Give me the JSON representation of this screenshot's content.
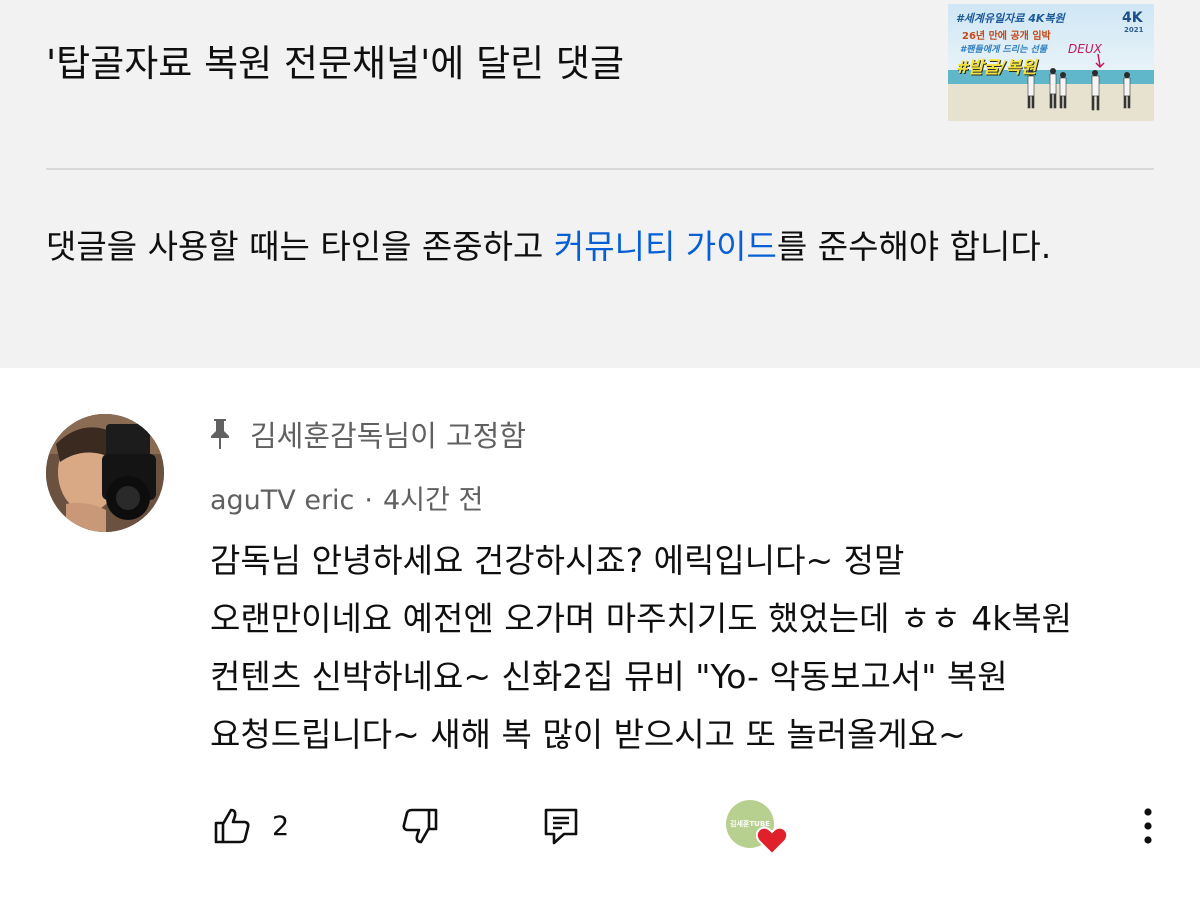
{
  "header": {
    "title": "'탑골자료 복원 전문채널'에 달린 댓글",
    "thumbnail": {
      "line1": "#세계유일자료 4K복원",
      "line2": "26년 만에 공개 임박",
      "line3": "#팬들에게 드리는 선물",
      "line4": "#발굴/복원",
      "badge": "4K",
      "year": "2021",
      "scribble": "DEUX"
    }
  },
  "notice": {
    "before": "댓글을 사용할 때는 타인을 존중하고 ",
    "link": "커뮤니티 가이드",
    "after": "를 준수해야 합니다."
  },
  "comment": {
    "pinned_by": "김세훈감독님이 고정함",
    "author": "aguTV eric",
    "separator": "·",
    "time": "4시간 전",
    "lines": [
      "감독님 안녕하세요 건강하시죠? 에릭입니다~ 정말",
      "오랜만이네요 예전엔 오가며 마주치기도 했었는데 ㅎㅎ 4k복원",
      "컨텐츠 신박하네요~ 신화2집 뮤비 \"Yo- 악동보고서\" 복원",
      "요청드립니다~ 새해 복 많이 받으시고 또 놀러올게요~"
    ],
    "likes": "2",
    "creator_badge_text": "김세훈TUBE"
  },
  "colors": {
    "link": "#065fd4",
    "secondary_text": "#606060",
    "panel_bg": "#f2f2f2",
    "heart": "#e0202a"
  },
  "icons": [
    "pin-icon",
    "thumbs-up-icon",
    "thumbs-down-icon",
    "reply-icon",
    "heart-icon",
    "more-vert-icon"
  ]
}
